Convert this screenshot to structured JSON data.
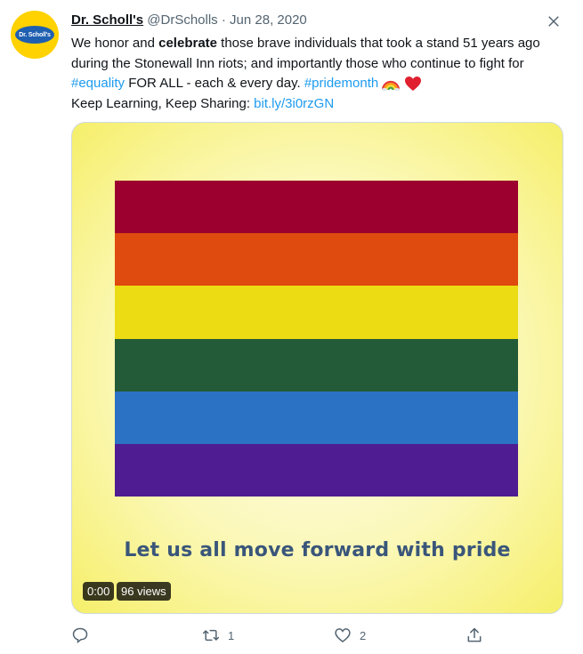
{
  "tweet": {
    "display_name": "Dr. Scholl's",
    "handle": "@DrScholls",
    "separator": "·",
    "date": "Jun 28, 2020",
    "avatar_text": "Dr. Scholl's",
    "text": {
      "line1_a": "We honor and ",
      "line1_bold": "celebrate",
      "line1_b": " those brave individuals that took a stand 51 years ago during the Stonewall Inn riots; and importantly those who continue to fight for ",
      "hashtag1": "#equality",
      "mid": " FOR ALL - each & every day. ",
      "hashtag2": "#pridemonth",
      "line2": "Keep Learning, Keep Sharing: ",
      "url": "bit.ly/3i0rzGN"
    },
    "emojis": [
      "rainbow-emoji",
      "red-heart-emoji"
    ]
  },
  "media": {
    "caption": "Let us all move forward with pride",
    "stripes": [
      "#9b002f",
      "#df4a0e",
      "#ecdc14",
      "#235a37",
      "#2b72c4",
      "#4f1c91"
    ],
    "video_time": "0:00",
    "views": "96 views"
  },
  "actions": {
    "reply_count": "",
    "retweet_count": "1",
    "like_count": "2"
  },
  "icons": [
    "more-icon",
    "reply-icon",
    "retweet-icon",
    "like-icon",
    "share-icon"
  ]
}
